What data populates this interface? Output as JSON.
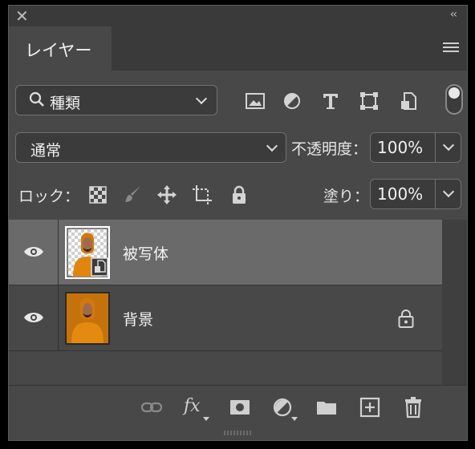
{
  "panel": {
    "close_glyph": "✕",
    "collapse_glyph": "‹‹",
    "tab_label": "レイヤー",
    "menu_icon": "hamburger-menu-icon"
  },
  "filter": {
    "search_label": "種類",
    "icons": [
      "image-filter-icon",
      "adjustment-filter-icon",
      "type-filter-icon",
      "shape-filter-icon",
      "smart-object-filter-icon"
    ],
    "toggle_state": "on"
  },
  "blend": {
    "mode": "通常",
    "opacity_label": "不透明度：",
    "opacity_value": "100%"
  },
  "lock": {
    "label": "ロック：",
    "icons": [
      "lock-transparent-pixels-icon",
      "lock-image-pixels-icon",
      "lock-position-icon",
      "lock-artboard-icon",
      "lock-all-icon"
    ],
    "fill_label": "塗り：",
    "fill_value": "100%"
  },
  "layers": [
    {
      "name": "被写体",
      "visible": true,
      "selected": true,
      "smart_object": true,
      "locked": false
    },
    {
      "name": "背景",
      "visible": true,
      "selected": false,
      "smart_object": false,
      "locked": true
    }
  ],
  "bottom_toolbar": {
    "icons": [
      "link-layers-icon",
      "fx-icon",
      "add-mask-icon",
      "new-adjustment-layer-icon",
      "new-group-icon",
      "new-layer-icon",
      "delete-layer-icon"
    ],
    "fx_text": "fx"
  },
  "colors": {
    "panel_bg": "#484848",
    "selected_row": "#6a6a6a",
    "hoodie_orange": "#e0860f"
  }
}
